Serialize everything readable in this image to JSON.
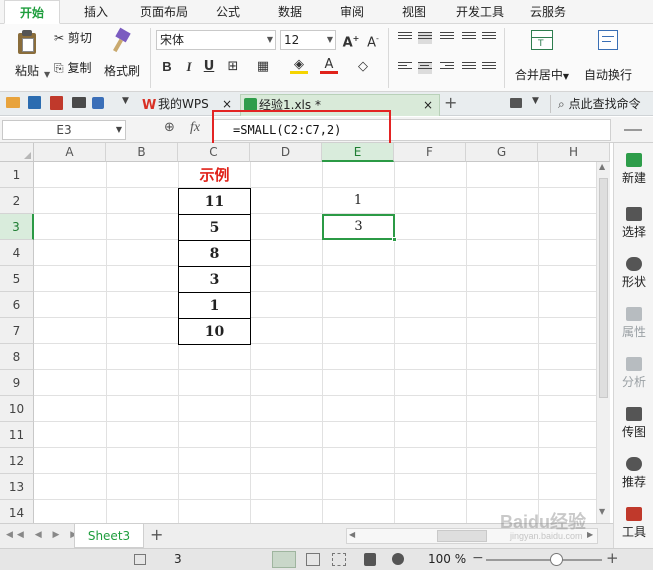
{
  "ribbon_tabs": [
    "开始",
    "插入",
    "页面布局",
    "公式",
    "数据",
    "审阅",
    "视图",
    "开发工具",
    "云服务"
  ],
  "ribbon": {
    "paste": "粘贴",
    "cut": "剪切",
    "copy": "复制",
    "format_painter": "格式刷",
    "font_name": "宋体",
    "font_size": "12",
    "bold": "B",
    "italic": "I",
    "underline": "U",
    "merge_center": "合并居中",
    "wrap_text": "自动换行"
  },
  "doc_tabs": {
    "my_wps": "我的WPS",
    "file": "经验1.xls *",
    "search": "点此查找命令"
  },
  "formula_bar": {
    "name_box": "E3",
    "fx": "fx",
    "formula": "=SMALL(C2:C7,2)"
  },
  "columns": [
    "A",
    "B",
    "C",
    "D",
    "E",
    "F",
    "G",
    "H"
  ],
  "rows": [
    "1",
    "2",
    "3",
    "4",
    "5",
    "6",
    "7",
    "8",
    "9",
    "10",
    "11",
    "12",
    "13",
    "14"
  ],
  "cells": {
    "c1": "示例",
    "c2": "11",
    "c3": "5",
    "c4": "8",
    "c5": "3",
    "c6": "1",
    "c7": "10",
    "e2": "1",
    "e3": "3"
  },
  "sidebar": [
    "新建",
    "选择",
    "形状",
    "属性",
    "分析",
    "传图",
    "推荐",
    "工具"
  ],
  "sheet_tab": "Sheet3",
  "status": {
    "count": "3",
    "zoom": "100 %"
  },
  "watermark": {
    "text": "Baidu经验",
    "url": "jingyan.baidu.com"
  },
  "colors": {
    "accent_green": "#1e9d3c",
    "title_red": "#e0221a",
    "highlight_red": "#e32323"
  }
}
